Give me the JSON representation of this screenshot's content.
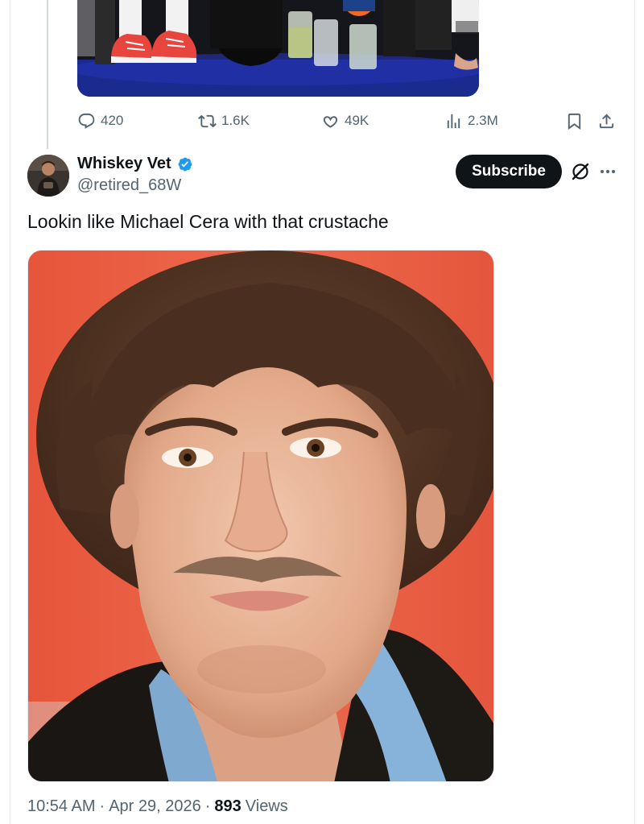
{
  "previous_tweet": {
    "actions": {
      "replies": "420",
      "reposts": "1.6K",
      "likes": "49K",
      "views": "2.3M"
    }
  },
  "tweet": {
    "author": {
      "display_name": "Whiskey Vet",
      "handle": "@retired_68W",
      "verified": true
    },
    "subscribe_label": "Subscribe",
    "text": "Lookin like Michael Cera with that crustache",
    "time": "10:54 AM",
    "separator": "·",
    "date": "Apr 29, 2026",
    "views_count": "893",
    "views_label": "Views"
  },
  "icons": {
    "reply": "reply-icon",
    "repost": "repost-icon",
    "like": "like-icon",
    "analytics": "analytics-icon",
    "bookmark": "bookmark-icon",
    "share": "share-icon",
    "verified": "verified-badge-icon",
    "grok": "grok-icon",
    "more": "more-icon"
  },
  "colors": {
    "text_primary": "#0f1419",
    "text_secondary": "#536471",
    "verified_blue": "#1d9bf0",
    "subscribe_bg": "#0f1419"
  }
}
